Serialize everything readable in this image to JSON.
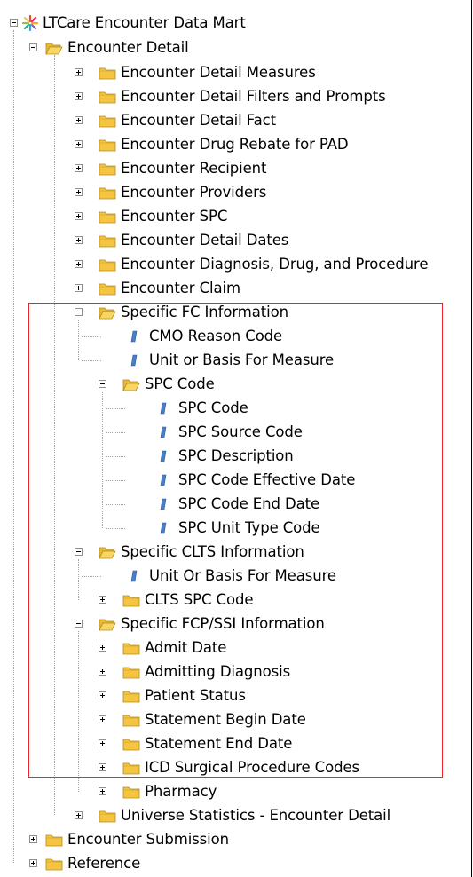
{
  "tree": {
    "root": {
      "label": "LTCare Encounter Data Mart",
      "icon": "star-icon"
    },
    "encounter_detail": {
      "label": "Encounter Detail",
      "children": [
        "Encounter Detail Measures",
        "Encounter Detail Filters and Prompts",
        "Encounter Detail Fact",
        "Encounter Drug Rebate for PAD",
        "Encounter Recipient",
        "Encounter Providers",
        "Encounter SPC",
        "Encounter Detail Dates",
        "Encounter Diagnosis, Drug, and Procedure",
        "Encounter Claim"
      ],
      "specific_fc": {
        "label": "Specific FC Information",
        "items": [
          "CMO Reason Code",
          "Unit or Basis For Measure"
        ],
        "spc_code": {
          "label": "SPC Code",
          "items": [
            "SPC Code",
            "SPC Source Code",
            "SPC Description",
            "SPC Code Effective Date",
            "SPC Code End Date",
            "SPC Unit Type Code"
          ]
        }
      },
      "specific_clts": {
        "label": "Specific CLTS Information",
        "items": [
          "Unit Or Basis For Measure"
        ],
        "folders": [
          "CLTS SPC Code"
        ]
      },
      "specific_fcp": {
        "label": "Specific FCP/SSI Information",
        "folders": [
          "Admit Date",
          "Admitting Diagnosis",
          "Patient Status",
          "Statement Begin Date",
          "Statement End Date",
          "ICD Surgical Procedure Codes",
          "Pharmacy"
        ]
      },
      "universe_stats": {
        "label": "Universe Statistics - Encounter Detail"
      }
    },
    "encounter_submission": {
      "label": "Encounter Submission"
    },
    "reference": {
      "label": "Reference"
    }
  },
  "colors": {
    "highlight_box": "#e8262b",
    "folder": "#f5c542",
    "object": "#4a7fc8"
  }
}
